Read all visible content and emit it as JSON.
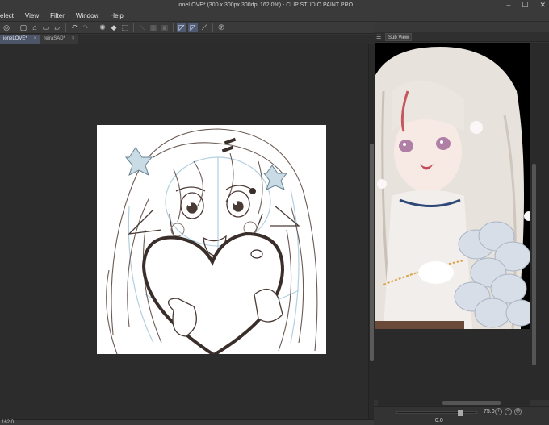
{
  "window": {
    "title": "ioneLOVE* (300 x 300px 300dpi 162.0%) - CLIP STUDIO PAINT PRO",
    "controls": [
      "–",
      "☐",
      "✕"
    ]
  },
  "menu": [
    "elect",
    "View",
    "Filter",
    "Window",
    "Help"
  ],
  "toolbar": {
    "icons": [
      "canvas-icon",
      "new-icon",
      "open-icon",
      "save-icon",
      "print-icon",
      "undo-icon",
      "redo-icon",
      "loading-icon",
      "fill-icon",
      "transform-icon",
      "ruler-icon",
      "grid-icon",
      "crop-icon",
      "snap-icon",
      "snap2-icon",
      "pen-icon",
      "sync-icon"
    ],
    "glyphs": [
      "◎",
      "▢",
      "⌂",
      "▭",
      "▱",
      "↶",
      "↷",
      "✺",
      "◆",
      "⬚",
      "⟍",
      "▦",
      "▣",
      "◸",
      "◸",
      "⟋",
      "⑦"
    ]
  },
  "tabs": [
    {
      "label": "ioneLOVE*",
      "close": "×"
    },
    {
      "label": "reiraSAD*",
      "close": "×"
    }
  ],
  "status": {
    "zoom": "162.0"
  },
  "subview": {
    "tab_label": "Sub View",
    "zoom": "75.0",
    "angle": "0.0"
  }
}
